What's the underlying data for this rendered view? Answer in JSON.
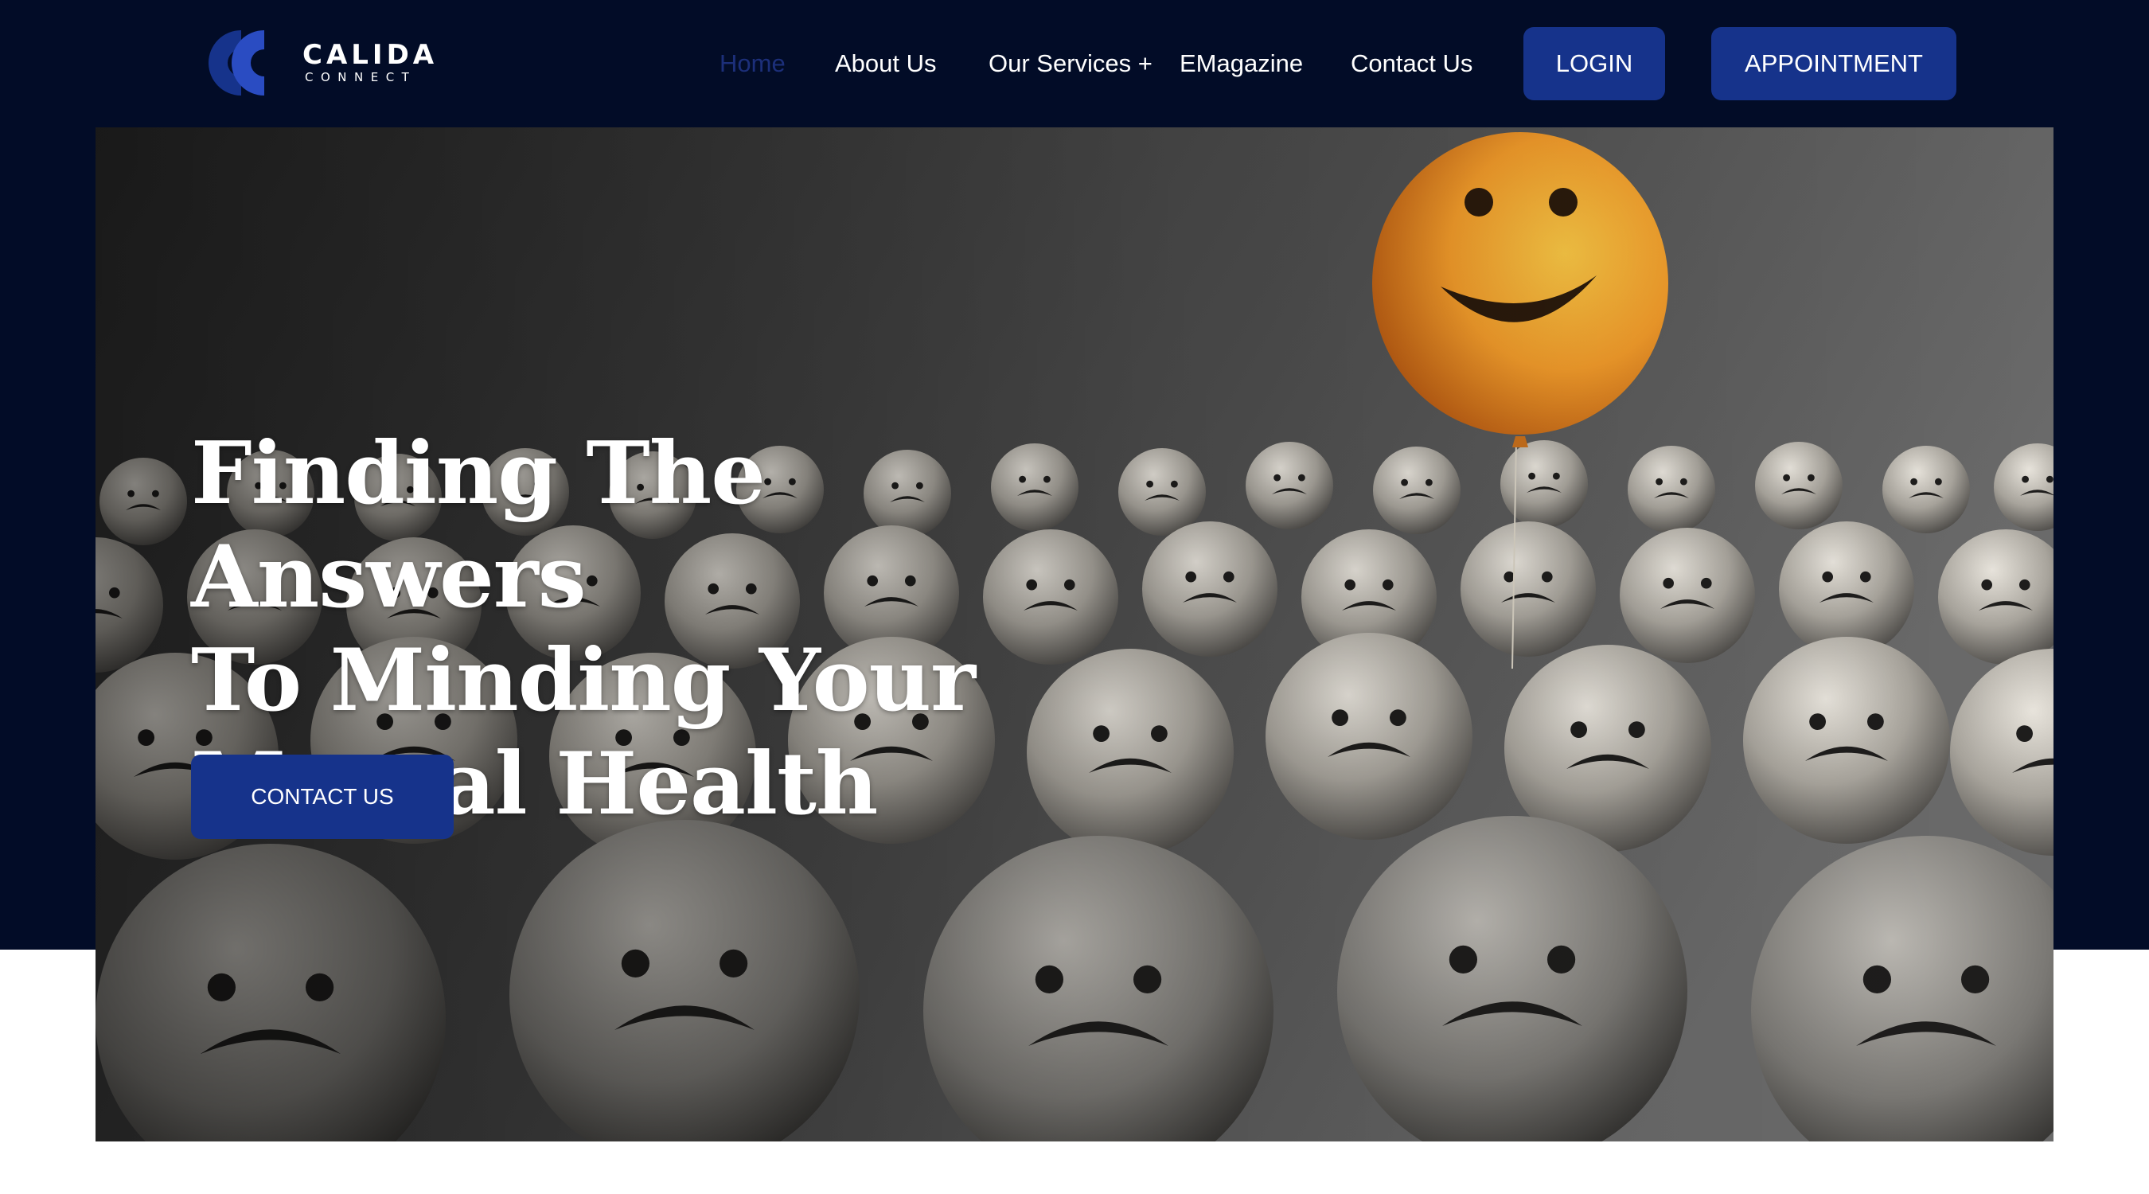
{
  "brand": {
    "name": "CALIDA",
    "tagline": "CONNECT",
    "colors": {
      "navy_background": "#020c27",
      "button_blue": "#16338b",
      "active_link": "#1c2f7a",
      "balloon_orange": "#f09a2a"
    }
  },
  "nav": {
    "items": [
      {
        "label": "Home",
        "active": true
      },
      {
        "label": "About Us"
      },
      {
        "label": "Our Services +"
      },
      {
        "label": "EMagazine"
      },
      {
        "label": "Contact Us"
      }
    ],
    "login_label": "LOGIN",
    "appointment_label": "APPOINTMENT"
  },
  "hero": {
    "title_lines": [
      "Finding The Answers",
      "To Minding Your",
      "Mental Health"
    ],
    "cta_label": "CONTACT US",
    "image": "smiley-balloon-among-sad-faces"
  }
}
